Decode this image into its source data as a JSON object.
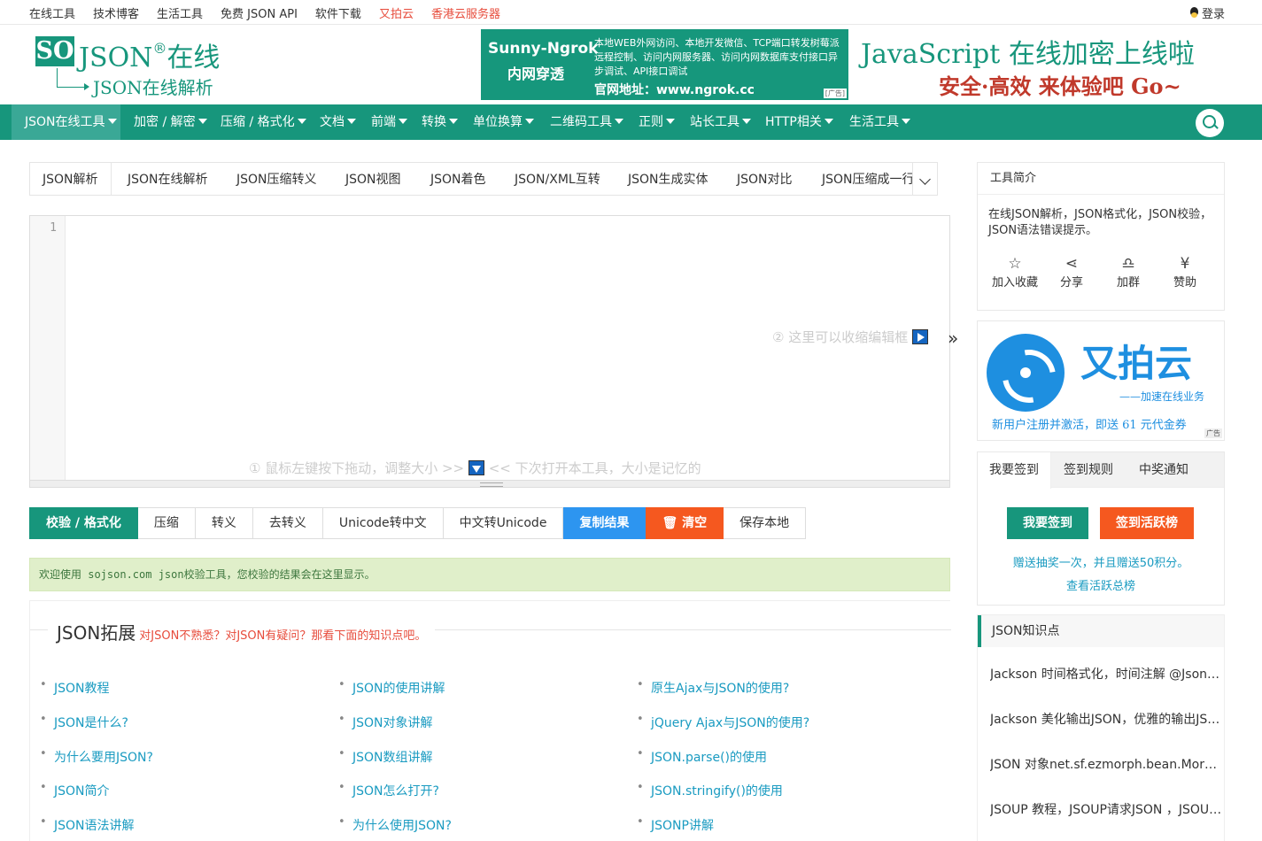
{
  "topbar": {
    "links": [
      "在线工具",
      "技术博客",
      "生活工具",
      "免费 JSON API",
      "软件下载",
      "又拍云",
      "香港云服务器"
    ],
    "login": "登录"
  },
  "logo": {
    "so": "SO",
    "json": "JSON",
    "reg": "®",
    "online": "在线",
    "sub": "JSON在线解析"
  },
  "ad_ngrok": {
    "title": "Sunny-Ngrok",
    "subtitle": "内网穿透",
    "desc": "本地WEB外网访问、本地开发微信、TCP端口转发树莓派远程控制、访问内网服务器、访问内网数据库支付接口异步调试、API接口调试",
    "url": "官网地址：www.ngrok.cc",
    "tag": "广告"
  },
  "ad_js": {
    "line1": "JavaScript 在线加密上线啦",
    "line2": "安全·高效 来体验吧 Go~"
  },
  "nav": {
    "items": [
      "JSON在线工具",
      "加密 / 解密",
      "压缩 / 格式化",
      "文档",
      "前端",
      "转换",
      "单位换算",
      "二维码工具",
      "正则",
      "站长工具",
      "HTTP相关",
      "生活工具"
    ]
  },
  "tabs": [
    "JSON解析",
    "JSON在线解析",
    "JSON压缩转义",
    "JSON视图",
    "JSON着色",
    "JSON/XML互转",
    "JSON生成实体",
    "JSON对比",
    "JSON压缩成一行"
  ],
  "editor": {
    "line_number": "1",
    "hint_right": "② 这里可以收缩编辑框",
    "hint_bottom_1": "① 鼠标左键按下拖动，调整大小 >>",
    "hint_bottom_2": "<< 下次打开本工具，大小是记忆的",
    "collapse_glyph": "»"
  },
  "actions": [
    "校验 / 格式化",
    "压缩",
    "转义",
    "去转义",
    "Unicode转中文",
    "中文转Unicode",
    "复制结果",
    "清空",
    "保存本地"
  ],
  "message": "欢迎使用 sojson.com json校验工具，您校验的结果会在这里显示。",
  "knowledge": {
    "title": "JSON拓展",
    "subtitle": "对JSON不熟悉？对JSON有疑问？那看下面的知识点吧。",
    "col1": [
      "JSON教程",
      "JSON是什么?",
      "为什么要用JSON?",
      "JSON简介",
      "JSON语法讲解"
    ],
    "col2": [
      "JSON的使用讲解",
      "JSON对象讲解",
      "JSON数组讲解",
      "JSON怎么打开?",
      "为什么使用JSON?"
    ],
    "col3": [
      "原生Ajax与JSON的使用?",
      "jQuery Ajax与JSON的使用?",
      "JSON.parse()的使用",
      "JSON.stringify()的使用",
      "JSONP讲解"
    ]
  },
  "tool_intro": {
    "title": "工具简介",
    "desc": "在线JSON解析，JSON格式化，JSON校验，JSON语法错误提示。",
    "icons": [
      {
        "glyph": "☆",
        "label": "加入收藏",
        "icon": "star-icon"
      },
      {
        "glyph": "⋖",
        "label": "分享",
        "icon": "share-icon"
      },
      {
        "glyph": "♎",
        "label": "加群",
        "icon": "qq-group-icon"
      },
      {
        "glyph": "¥",
        "label": "赞助",
        "icon": "yen-icon"
      }
    ]
  },
  "upyun": {
    "brand": "又拍云",
    "slogan": "——加速在线业务",
    "promo": "新用户注册并激活，即送 61 元代金券",
    "tag": "广告"
  },
  "signin": {
    "tabs": [
      "我要签到",
      "签到规则",
      "中奖通知"
    ],
    "btn_sign": "我要签到",
    "btn_rank": "签到活跃榜",
    "note": "赠送抽奖一次，并且赠送50积分。",
    "link": "查看活跃总榜"
  },
  "kp": {
    "title": "JSON知识点",
    "items": [
      "Jackson 时间格式化，时间注解 @JsonFormat 用法",
      "Jackson 美化输出JSON，优雅的输出JSON数据",
      "JSON 对象net.sf.ezmorph.bean.MorphDynaBean",
      "JSOUP 教程，JSOUP请求JSON ，JSOUP获取"
    ]
  },
  "colors": {
    "brand": "#17967c",
    "blue": "#2d95f0",
    "orange": "#f5581f",
    "link": "#1a9bc1"
  }
}
